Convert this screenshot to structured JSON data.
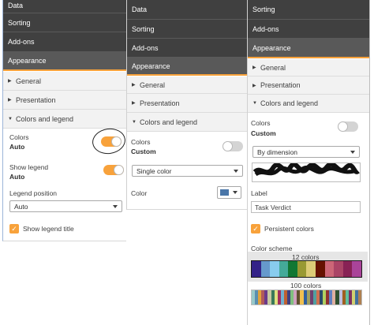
{
  "panel1": {
    "tabs": [
      "Data",
      "Sorting",
      "Add-ons",
      "Appearance"
    ],
    "sections": [
      "General",
      "Presentation",
      "Colors and legend"
    ],
    "colors_label": "Colors",
    "colors_value": "Auto",
    "colors_toggle_on": true,
    "show_legend_label": "Show legend",
    "show_legend_value": "Auto",
    "show_legend_toggle_on": true,
    "legend_position_label": "Legend position",
    "legend_position_value": "Auto",
    "show_legend_title_label": "Show legend title",
    "show_legend_title_checked": true
  },
  "panel2": {
    "tabs": [
      "Data",
      "Sorting",
      "Add-ons",
      "Appearance"
    ],
    "sections": [
      "General",
      "Presentation",
      "Colors and legend"
    ],
    "colors_label": "Colors",
    "colors_value": "Custom",
    "colors_toggle_on": false,
    "color_mode_value": "Single color",
    "color_label": "Color",
    "color_swatch": "#4a76a8"
  },
  "panel3": {
    "tabs": [
      "Sorting",
      "Add-ons",
      "Appearance"
    ],
    "sections": [
      "General",
      "Presentation",
      "Colors and legend"
    ],
    "colors_label": "Colors",
    "colors_value": "Custom",
    "colors_toggle_on": false,
    "color_mode_value": "By dimension",
    "label_label": "Label",
    "label_value": "Task Verdict",
    "persistent_colors_label": "Persistent colors",
    "persistent_colors_checked": true,
    "color_scheme_label": "Color scheme",
    "scheme_12_label": "12 colors",
    "scheme_100_label": "100 colors",
    "scheme_12": [
      "#332288",
      "#6699cc",
      "#88ccee",
      "#44aa99",
      "#117733",
      "#999933",
      "#ddcc77",
      "#661100",
      "#cc6677",
      "#aa4466",
      "#882255",
      "#aa4499"
    ],
    "scheme_100": [
      "#99c9c9",
      "#5a8fb0",
      "#e1a23b",
      "#b05a5a",
      "#6b3a8a",
      "#c8c8a0",
      "#3a7a5a",
      "#e0e080",
      "#a03060",
      "#70b0d0",
      "#c06030",
      "#404080",
      "#80c080",
      "#d0a0c0",
      "#605030",
      "#f0c050",
      "#3060a0",
      "#a0a060",
      "#704070",
      "#50a0a0",
      "#d07050",
      "#2a4a6a",
      "#b0d060",
      "#903030",
      "#6080c0",
      "#e0b0a0",
      "#305030",
      "#c0c0e0",
      "#a06020",
      "#60c0a0",
      "#803060",
      "#d0d070",
      "#4070a0",
      "#b08050"
    ],
    "accent": "#f8a23b"
  }
}
